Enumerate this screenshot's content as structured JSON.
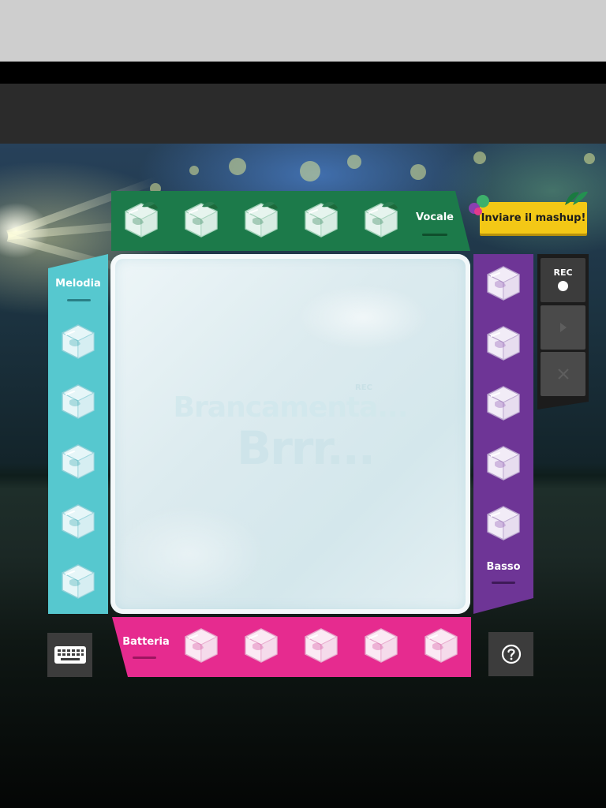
{
  "header": {},
  "panels": {
    "vocale": {
      "label": "Vocale",
      "color": "#1c7a4a",
      "cube_color": "green",
      "cube_count": 5
    },
    "melodia": {
      "label": "Melodia",
      "color": "#56c8cf",
      "cube_color": "teal",
      "cube_count": 5
    },
    "basso": {
      "label": "Basso",
      "color": "#6e3596",
      "cube_color": "purple",
      "cube_count": 5
    },
    "batteria": {
      "label": "Batteria",
      "color": "#e62b8f",
      "cube_color": "pink",
      "cube_count": 5
    }
  },
  "stage": {
    "title": "Brancamenta...",
    "subtitle": "Brrr...",
    "rec_label": "REC"
  },
  "send_button": {
    "label": "Inviare il mashup!"
  },
  "controls": {
    "rec_label": "REC",
    "play_icon": "play-icon",
    "close_icon": "close-icon"
  },
  "bottom": {
    "keyboard_icon": "keyboard-icon",
    "help_icon": "help-icon"
  }
}
